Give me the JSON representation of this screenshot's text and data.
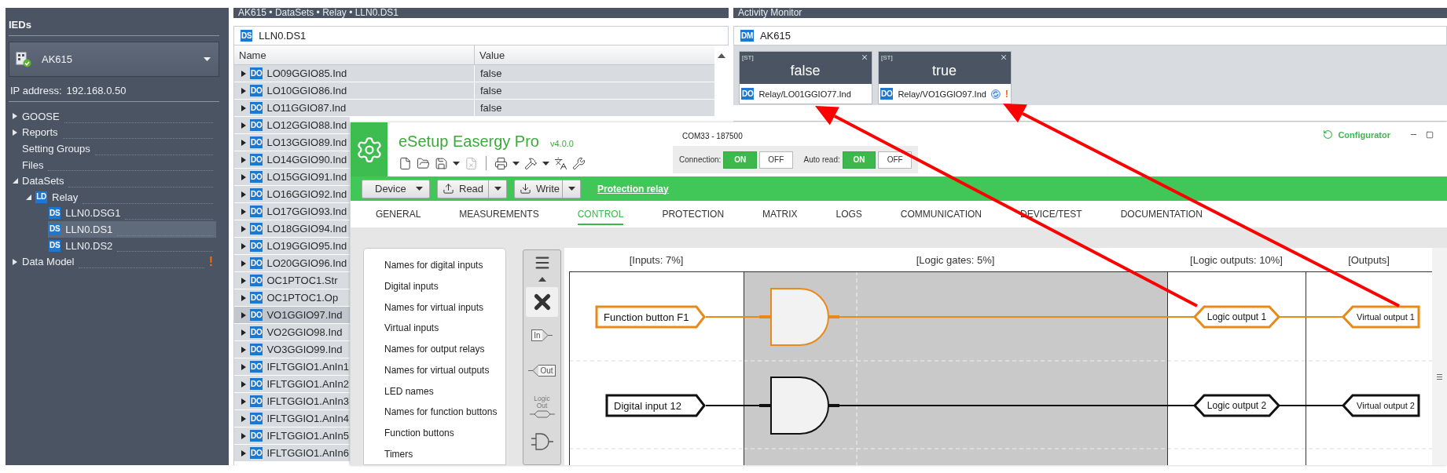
{
  "ieds": {
    "title": "IEDs",
    "device": "AK615",
    "ip_label": "IP address:",
    "ip_value": "192.168.0.50",
    "tree": [
      {
        "label": "GOOSE",
        "expanded": false,
        "selected": false
      },
      {
        "label": "Reports",
        "expanded": false,
        "selected": false
      },
      {
        "label": "Setting Groups",
        "selected": false
      },
      {
        "label": "Files",
        "selected": false
      },
      {
        "label": "DataSets",
        "expanded": true,
        "selected": false,
        "children": [
          {
            "label": "Relay",
            "type": "LD",
            "expanded": true,
            "selected": false,
            "children": [
              {
                "label": "LLN0.DSG1",
                "type": "DS",
                "selected": false
              },
              {
                "label": "LLN0.DS1",
                "type": "DS",
                "selected": true
              },
              {
                "label": "LLN0.DS2",
                "type": "DS",
                "selected": false
              }
            ]
          }
        ]
      },
      {
        "label": "Data Model",
        "expanded": false,
        "selected": false,
        "alert": "!"
      }
    ]
  },
  "dataset": {
    "breadcrumb": "AK615 • DataSets • Relay • LLN0.DS1",
    "type": "DS",
    "title": "LLN0.DS1",
    "columns": [
      "Name",
      "Value"
    ],
    "rows": [
      {
        "type": "DO",
        "name": "LO09GGIO85.Ind",
        "value": "false",
        "selected": false
      },
      {
        "type": "DO",
        "name": "LO10GGIO86.Ind",
        "value": "false",
        "selected": false
      },
      {
        "type": "DO",
        "name": "LO11GGIO87.Ind",
        "value": "false",
        "selected": false
      },
      {
        "type": "DO",
        "name": "LO12GGIO88.Ind",
        "selected": false
      },
      {
        "type": "DO",
        "name": "LO13GGIO89.Ind",
        "selected": false
      },
      {
        "type": "DO",
        "name": "LO14GGIO90.Ind",
        "selected": false
      },
      {
        "type": "DO",
        "name": "LO15GGIO91.Ind",
        "selected": false
      },
      {
        "type": "DO",
        "name": "LO16GGIO92.Ind",
        "selected": false
      },
      {
        "type": "DO",
        "name": "LO17GGIO93.Ind",
        "selected": false
      },
      {
        "type": "DO",
        "name": "LO18GGIO94.Ind",
        "selected": false
      },
      {
        "type": "DO",
        "name": "LO19GGIO95.Ind",
        "selected": false
      },
      {
        "type": "DO",
        "name": "LO20GGIO96.Ind",
        "selected": false
      },
      {
        "type": "DO",
        "name": "OC1PTOC1.Str",
        "selected": false
      },
      {
        "type": "DO",
        "name": "OC1PTOC1.Op",
        "selected": false
      },
      {
        "type": "DO",
        "name": "VO1GGIO97.Ind",
        "selected": true
      },
      {
        "type": "DO",
        "name": "VO2GGIO98.Ind",
        "selected": false
      },
      {
        "type": "DO",
        "name": "VO3GGIO99.Ind",
        "selected": false
      },
      {
        "type": "DO",
        "name": "IFLTGGIO1.AnIn1",
        "selected": false
      },
      {
        "type": "DO",
        "name": "IFLTGGIO1.AnIn2",
        "selected": false
      },
      {
        "type": "DO",
        "name": "IFLTGGIO1.AnIn3",
        "selected": false
      },
      {
        "type": "DO",
        "name": "IFLTGGIO1.AnIn4",
        "selected": false
      },
      {
        "type": "DO",
        "name": "IFLTGGIO1.AnIn5",
        "selected": false
      },
      {
        "type": "DO",
        "name": "IFLTGGIO1.AnIn6",
        "selected": false
      }
    ]
  },
  "activity_monitor": {
    "title": "Activity Monitor",
    "type": "DM",
    "device": "AK615",
    "cards": [
      {
        "tag": "[ST]",
        "value": "false",
        "type": "DO",
        "path": "Relay/LO01GGIO77.Ind"
      },
      {
        "tag": "[ST]",
        "value": "true",
        "type": "DO",
        "path": "Relay/VO1GGIO97.Ind",
        "alert": "!"
      }
    ]
  },
  "esetup": {
    "app_name": "eSetup Easergy Pro",
    "version": "v4.0.0",
    "toolbar": [
      {
        "kind": "new",
        "disabled": false
      },
      {
        "kind": "open",
        "disabled": false
      },
      {
        "kind": "save",
        "disabled": false,
        "menu": true
      },
      {
        "kind": "close",
        "disabled": true
      },
      {
        "kind": "separator"
      },
      {
        "kind": "print",
        "disabled": false,
        "menu": true
      },
      {
        "kind": "tools",
        "disabled": false,
        "menu": true
      },
      {
        "kind": "language",
        "disabled": false
      },
      {
        "kind": "settings",
        "disabled": false
      }
    ],
    "port": "COM33 - 187500",
    "switches": [
      {
        "label": "Connection:",
        "options": [
          {
            "label": "ON",
            "selected": true
          },
          {
            "label": "OFF",
            "selected": false
          }
        ]
      },
      {
        "label": "Auto read:",
        "options": [
          {
            "label": "ON",
            "selected": true
          },
          {
            "label": "OFF",
            "selected": false
          }
        ]
      }
    ],
    "mode": "Configurator",
    "actions": [
      {
        "label": "Device",
        "kind": "dropdown"
      },
      {
        "label": "Read",
        "kind": "read"
      },
      {
        "label": "Write",
        "kind": "write"
      }
    ],
    "device_link": "Protection relay",
    "tabs": [
      {
        "label": "GENERAL",
        "selected": false
      },
      {
        "label": "MEASUREMENTS",
        "selected": false
      },
      {
        "label": "CONTROL",
        "selected": true
      },
      {
        "label": "PROTECTION",
        "selected": false
      },
      {
        "label": "MATRIX",
        "selected": false
      },
      {
        "label": "LOGS",
        "selected": false
      },
      {
        "label": "COMMUNICATION",
        "selected": false
      },
      {
        "label": "DEVICE/TEST",
        "selected": false
      },
      {
        "label": "DOCUMENTATION",
        "selected": false
      }
    ],
    "menu": [
      "Names for digital inputs",
      "Digital inputs",
      "Names for virtual inputs",
      "Virtual inputs",
      "Names for output relays",
      "Names for virtual outputs",
      "LED names",
      "Names for function buttons",
      "Function buttons",
      "Timers"
    ],
    "palette": [
      {
        "kind": "menu",
        "selected": false
      },
      {
        "kind": "scroll_up",
        "selected": false
      },
      {
        "kind": "delete",
        "selected": true
      },
      {
        "kind": "input",
        "label": "In",
        "selected": false
      },
      {
        "kind": "output",
        "label": "Out",
        "selected": false
      },
      {
        "kind": "logic_output",
        "label": "Logic Out",
        "selected": false
      },
      {
        "kind": "and_gate",
        "selected": false
      }
    ],
    "diagram": {
      "columns": [
        "[Inputs: 7%]",
        "[Logic gates: 5%]",
        "[Logic outputs: 10%]",
        "[Outputs]"
      ],
      "rows": [
        {
          "input": "Function button F1",
          "logic_output": "Logic output 1",
          "output": "Virtual output 1",
          "selected": true
        },
        {
          "input": "Digital input 12",
          "logic_output": "Logic output 2",
          "output": "Virtual output 2",
          "selected": false
        }
      ]
    }
  }
}
